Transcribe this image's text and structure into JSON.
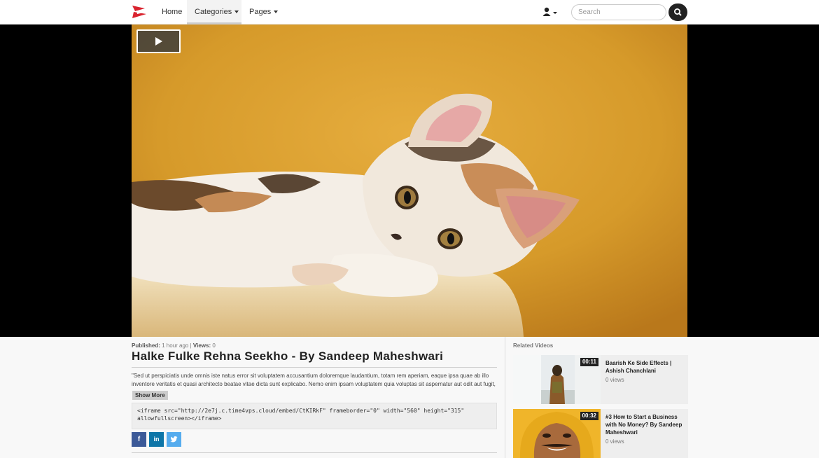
{
  "nav": {
    "home": "Home",
    "categories": "Categories",
    "pages": "Pages",
    "search_placeholder": "Search"
  },
  "video": {
    "published_label": "Published:",
    "published_value": "1 hour ago",
    "views_label": "Views:",
    "views_value": "0",
    "title": "Halke Fulke Rehna Seekho - By Sandeep Maheshwari",
    "description": "\"Sed ut perspiciatis unde omnis iste natus error sit voluptatem accusantium doloremque laudantium, totam rem aperiam, eaque ipsa quae ab illo inventore veritatis et quasi architecto beatae vitae dicta sunt explicabo. Nemo enim ipsam voluptatem quia voluptas sit aspernatur aut odit aut fugit, sed quia consequuntur magni dolores eos qui ratione voluptatem sequi nesciunt.",
    "show_more": "Show More",
    "embed_code": "<iframe src=\"http://2e7j.c.time4vps.cloud/embed/CtKIRkF\" frameborder=\"0\" width=\"560\" height=\"315\" allowfullscreen></iframe>"
  },
  "social": {
    "facebook": "f",
    "linkedin": "in",
    "twitter": "t"
  },
  "related": {
    "heading": "Related Videos",
    "items": [
      {
        "duration": "00:11",
        "title": "Baarish Ke Side Effects | Ashish Chanchlani",
        "views": "0 views"
      },
      {
        "duration": "00:32",
        "title": "#3 How to Start a Business with No Money? By Sandeep Maheshwari",
        "views": "0 views"
      }
    ]
  },
  "colors": {
    "facebook": "#3b5998",
    "linkedin": "#0e76a8",
    "twitter": "#55acee",
    "logo": "#d9232e"
  }
}
